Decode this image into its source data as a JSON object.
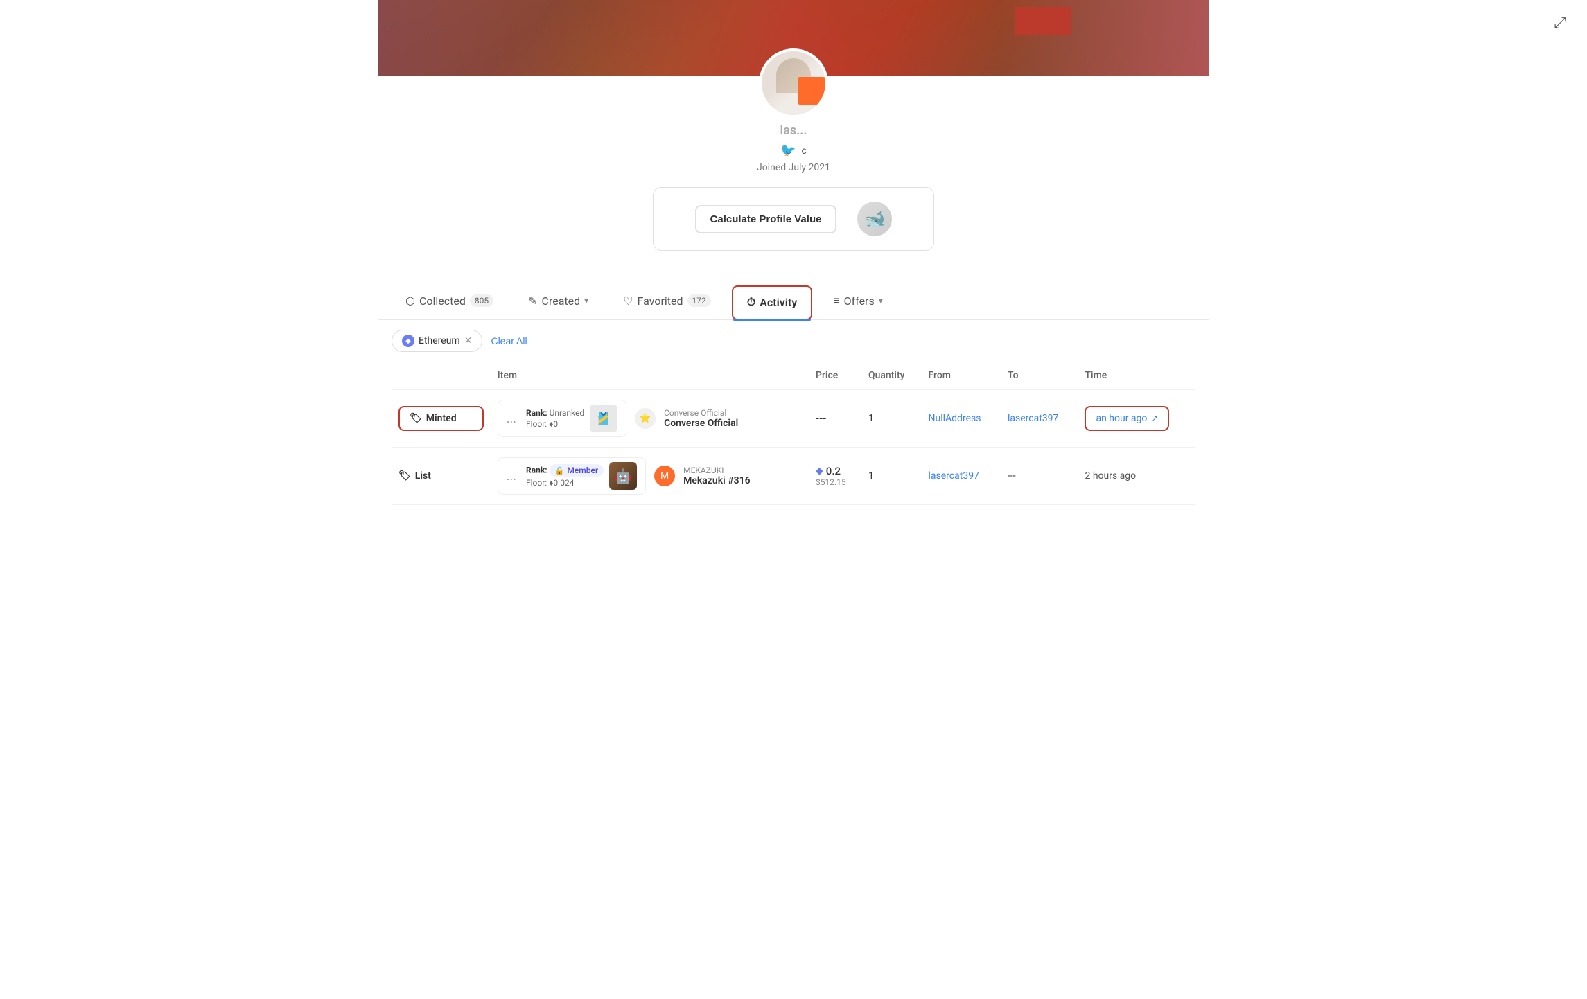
{
  "banner": {
    "alt": "Profile banner"
  },
  "share": {
    "icon": "⤢",
    "label": "Share"
  },
  "profile": {
    "username": "las...",
    "joined": "Joined July 2021",
    "twitter_handle": "c",
    "calculate_button": "Calculate Profile Value"
  },
  "tabs": [
    {
      "id": "collected",
      "label": "Collected",
      "count": "805",
      "icon": "⬡",
      "active": false,
      "dropdown": false
    },
    {
      "id": "created",
      "label": "Created",
      "count": null,
      "icon": "✎",
      "active": false,
      "dropdown": true
    },
    {
      "id": "favorited",
      "label": "Favorited",
      "count": "172",
      "icon": "♡",
      "active": false,
      "dropdown": false
    },
    {
      "id": "activity",
      "label": "Activity",
      "count": null,
      "icon": "⏱",
      "active": true,
      "dropdown": false
    },
    {
      "id": "offers",
      "label": "Offers",
      "count": null,
      "icon": "≡",
      "active": false,
      "dropdown": true
    }
  ],
  "filters": {
    "chips": [
      {
        "id": "ethereum",
        "label": "Ethereum",
        "removable": true
      }
    ],
    "clear_all": "Clear All"
  },
  "table": {
    "headers": [
      "",
      "Item",
      "Price",
      "Quantity",
      "From",
      "To",
      "Time"
    ],
    "rows": [
      {
        "event_type": "Minted",
        "event_icon": "🏷",
        "highlighted": true,
        "item_dots": "...",
        "item_rank_label": "Rank:",
        "item_rank_value": "Unranked",
        "item_floor_label": "Floor:",
        "item_floor_eth": "♦",
        "item_floor_value": "0",
        "collection_icon_type": "converse",
        "collection_name": "Converse Official",
        "item_name": "Converse Official",
        "price": "---",
        "quantity": "1",
        "from": "NullAddress",
        "from_link": true,
        "to": "lasercat397",
        "to_link": true,
        "time": "an hour ago",
        "time_highlighted": true,
        "external_link": true
      },
      {
        "event_type": "List",
        "event_icon": "🏷",
        "highlighted": false,
        "item_dots": "...",
        "item_rank_label": "Rank:",
        "item_rank_value": "Member",
        "item_rank_badge": true,
        "item_floor_label": "Floor:",
        "item_floor_eth": "♦",
        "item_floor_value": "0.024",
        "collection_icon_type": "mekazuki",
        "collection_name": "MEKAZUKI",
        "item_name": "Mekazuki #316",
        "price_eth": "0.2",
        "price_usd": "$512.15",
        "quantity": "1",
        "from": "lasercat397",
        "from_link": true,
        "to": "---",
        "to_link": false,
        "time": "2 hours ago",
        "time_highlighted": false,
        "external_link": false
      }
    ]
  }
}
